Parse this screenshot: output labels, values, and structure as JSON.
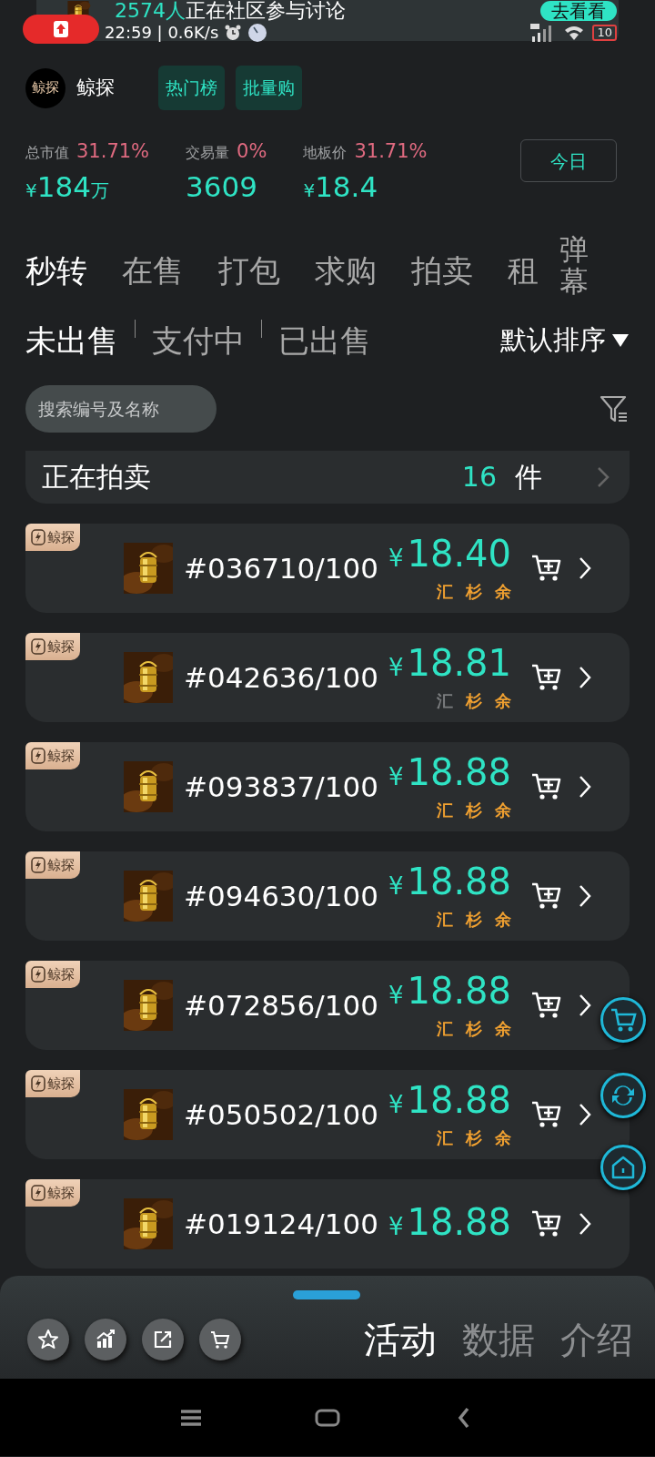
{
  "banner": {
    "count": "2574人",
    "text": "正在社区参与讨论",
    "button": "去看看"
  },
  "status_bar": {
    "time": "22:59 | 0.6K/s",
    "battery": "10"
  },
  "brand": {
    "logo": "鲸探",
    "name": "鲸探"
  },
  "header_buttons": [
    "热门榜",
    "批量购"
  ],
  "stats": [
    {
      "label": "总市值",
      "change": "31.71%",
      "currency": "¥",
      "value": "184",
      "unit": "万"
    },
    {
      "label": "交易量",
      "change": "0%",
      "value": "3609"
    },
    {
      "label": "地板价",
      "change": "31.71%",
      "currency": "¥",
      "value": "18.4"
    }
  ],
  "period_button": "今日",
  "tabs": [
    {
      "label": "秒转",
      "selected": true
    },
    {
      "label": "在售",
      "selected": false
    },
    {
      "label": "打包",
      "selected": false
    },
    {
      "label": "求购",
      "selected": false
    },
    {
      "label": "拍卖",
      "selected": false
    },
    {
      "label": "租",
      "selected": false
    }
  ],
  "danmaku": "弹幕",
  "sub_tabs": [
    {
      "label": "未出售",
      "selected": true
    },
    {
      "label": "支付中",
      "selected": false
    },
    {
      "label": "已出售",
      "selected": false
    }
  ],
  "sort": "默认排序",
  "search": {
    "placeholder": "搜索编号及名称"
  },
  "auction": {
    "label": "正在拍卖",
    "count": "16",
    "unit": "件"
  },
  "items": [
    {
      "badge": "鲸探",
      "serial": "#036710/100",
      "currency": "¥",
      "price": "18.40",
      "tags": [
        {
          "text": "汇",
          "on": true
        },
        {
          "text": "杉",
          "on": true
        },
        {
          "text": "余",
          "on": true
        }
      ]
    },
    {
      "badge": "鲸探",
      "serial": "#042636/100",
      "currency": "¥",
      "price": "18.81",
      "tags": [
        {
          "text": "汇",
          "on": false
        },
        {
          "text": "杉",
          "on": true
        },
        {
          "text": "余",
          "on": true
        }
      ]
    },
    {
      "badge": "鲸探",
      "serial": "#093837/100",
      "currency": "¥",
      "price": "18.88",
      "tags": [
        {
          "text": "汇",
          "on": true
        },
        {
          "text": "杉",
          "on": true
        },
        {
          "text": "余",
          "on": true
        }
      ]
    },
    {
      "badge": "鲸探",
      "serial": "#094630/100",
      "currency": "¥",
      "price": "18.88",
      "tags": [
        {
          "text": "汇",
          "on": true
        },
        {
          "text": "杉",
          "on": true
        },
        {
          "text": "余",
          "on": true
        }
      ]
    },
    {
      "badge": "鲸探",
      "serial": "#072856/100",
      "currency": "¥",
      "price": "18.88",
      "tags": [
        {
          "text": "汇",
          "on": true
        },
        {
          "text": "杉",
          "on": true
        },
        {
          "text": "余",
          "on": true
        }
      ]
    },
    {
      "badge": "鲸探",
      "serial": "#050502/100",
      "currency": "¥",
      "price": "18.88",
      "tags": [
        {
          "text": "汇",
          "on": true
        },
        {
          "text": "杉",
          "on": true
        },
        {
          "text": "余",
          "on": true
        }
      ]
    },
    {
      "badge": "鲸探",
      "serial": "#019124/100",
      "currency": "¥",
      "price": "18.88"
    }
  ],
  "sheet_tabs": [
    {
      "label": "活动",
      "selected": true
    },
    {
      "label": "数据",
      "selected": false
    },
    {
      "label": "介绍",
      "selected": false
    }
  ]
}
